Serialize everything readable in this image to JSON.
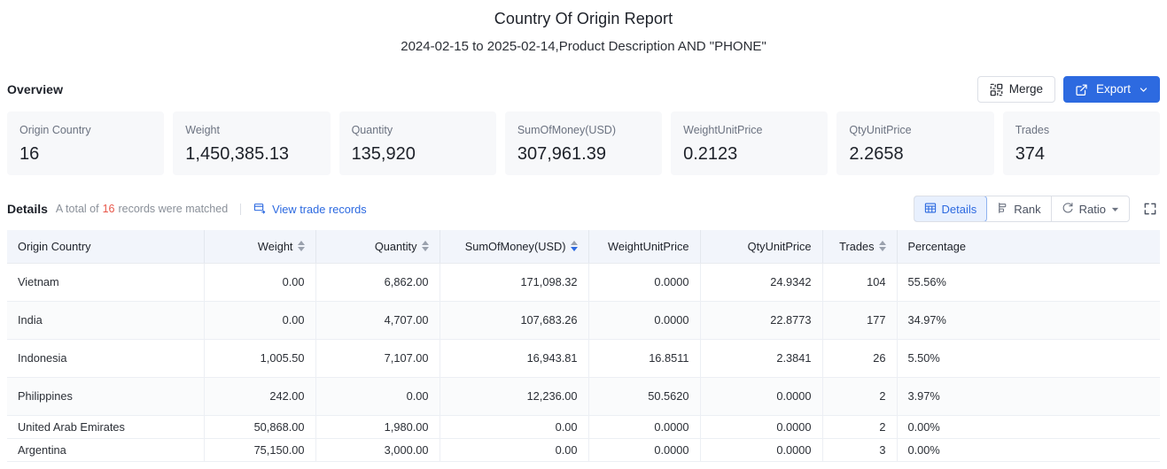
{
  "report": {
    "title": "Country Of Origin Report",
    "subtitle": "2024-02-15 to 2025-02-14,Product Description AND \"PHONE\""
  },
  "overview": {
    "section_label": "Overview",
    "merge_label": "Merge",
    "export_label": "Export",
    "cards": [
      {
        "label": "Origin Country",
        "value": "16"
      },
      {
        "label": "Weight",
        "value": "1,450,385.13"
      },
      {
        "label": "Quantity",
        "value": "135,920"
      },
      {
        "label": "SumOfMoney(USD)",
        "value": "307,961.39"
      },
      {
        "label": "WeightUnitPrice",
        "value": "0.2123"
      },
      {
        "label": "QtyUnitPrice",
        "value": "2.2658"
      },
      {
        "label": "Trades",
        "value": "374"
      }
    ]
  },
  "details": {
    "title": "Details",
    "meta_prefix": "A total of",
    "count": "16",
    "meta_suffix": "records were matched",
    "view_records_label": "View trade records",
    "view_tabs": [
      {
        "label": "Details",
        "active": true
      },
      {
        "label": "Rank",
        "active": false
      },
      {
        "label": "Ratio",
        "active": false
      }
    ]
  },
  "table": {
    "columns": [
      {
        "label": "Origin Country",
        "align": "left",
        "sortable": false,
        "sort": "none"
      },
      {
        "label": "Weight",
        "align": "right",
        "sortable": true,
        "sort": "none"
      },
      {
        "label": "Quantity",
        "align": "right",
        "sortable": true,
        "sort": "none"
      },
      {
        "label": "SumOfMoney(USD)",
        "align": "right",
        "sortable": true,
        "sort": "desc"
      },
      {
        "label": "WeightUnitPrice",
        "align": "right",
        "sortable": false,
        "sort": "none"
      },
      {
        "label": "QtyUnitPrice",
        "align": "right",
        "sortable": false,
        "sort": "none"
      },
      {
        "label": "Trades",
        "align": "right",
        "sortable": true,
        "sort": "none"
      },
      {
        "label": "Percentage",
        "align": "left",
        "sortable": false,
        "sort": "none"
      }
    ],
    "rows": [
      {
        "cells": [
          "Vietnam",
          "0.00",
          "6,862.00",
          "171,098.32",
          "0.0000",
          "24.9342",
          "104",
          "55.56%"
        ]
      },
      {
        "cells": [
          "India",
          "0.00",
          "4,707.00",
          "107,683.26",
          "0.0000",
          "22.8773",
          "177",
          "34.97%"
        ]
      },
      {
        "cells": [
          "Indonesia",
          "1,005.50",
          "7,107.00",
          "16,943.81",
          "16.8511",
          "2.3841",
          "26",
          "5.50%"
        ]
      },
      {
        "cells": [
          "Philippines",
          "242.00",
          "0.00",
          "12,236.00",
          "50.5620",
          "0.0000",
          "2",
          "3.97%"
        ]
      },
      {
        "cells": [
          "United Arab Emirates",
          "50,868.00",
          "1,980.00",
          "0.00",
          "0.0000",
          "0.0000",
          "2",
          "0.00%"
        ]
      },
      {
        "cells": [
          "Argentina",
          "75,150.00",
          "3,000.00",
          "0.00",
          "0.0000",
          "0.0000",
          "3",
          "0.00%"
        ]
      }
    ]
  },
  "colors": {
    "accent": "#2d6ae0",
    "count_red": "#e8574a",
    "card_bg": "#f7f8fa",
    "header_bg": "#f2f5fb"
  }
}
